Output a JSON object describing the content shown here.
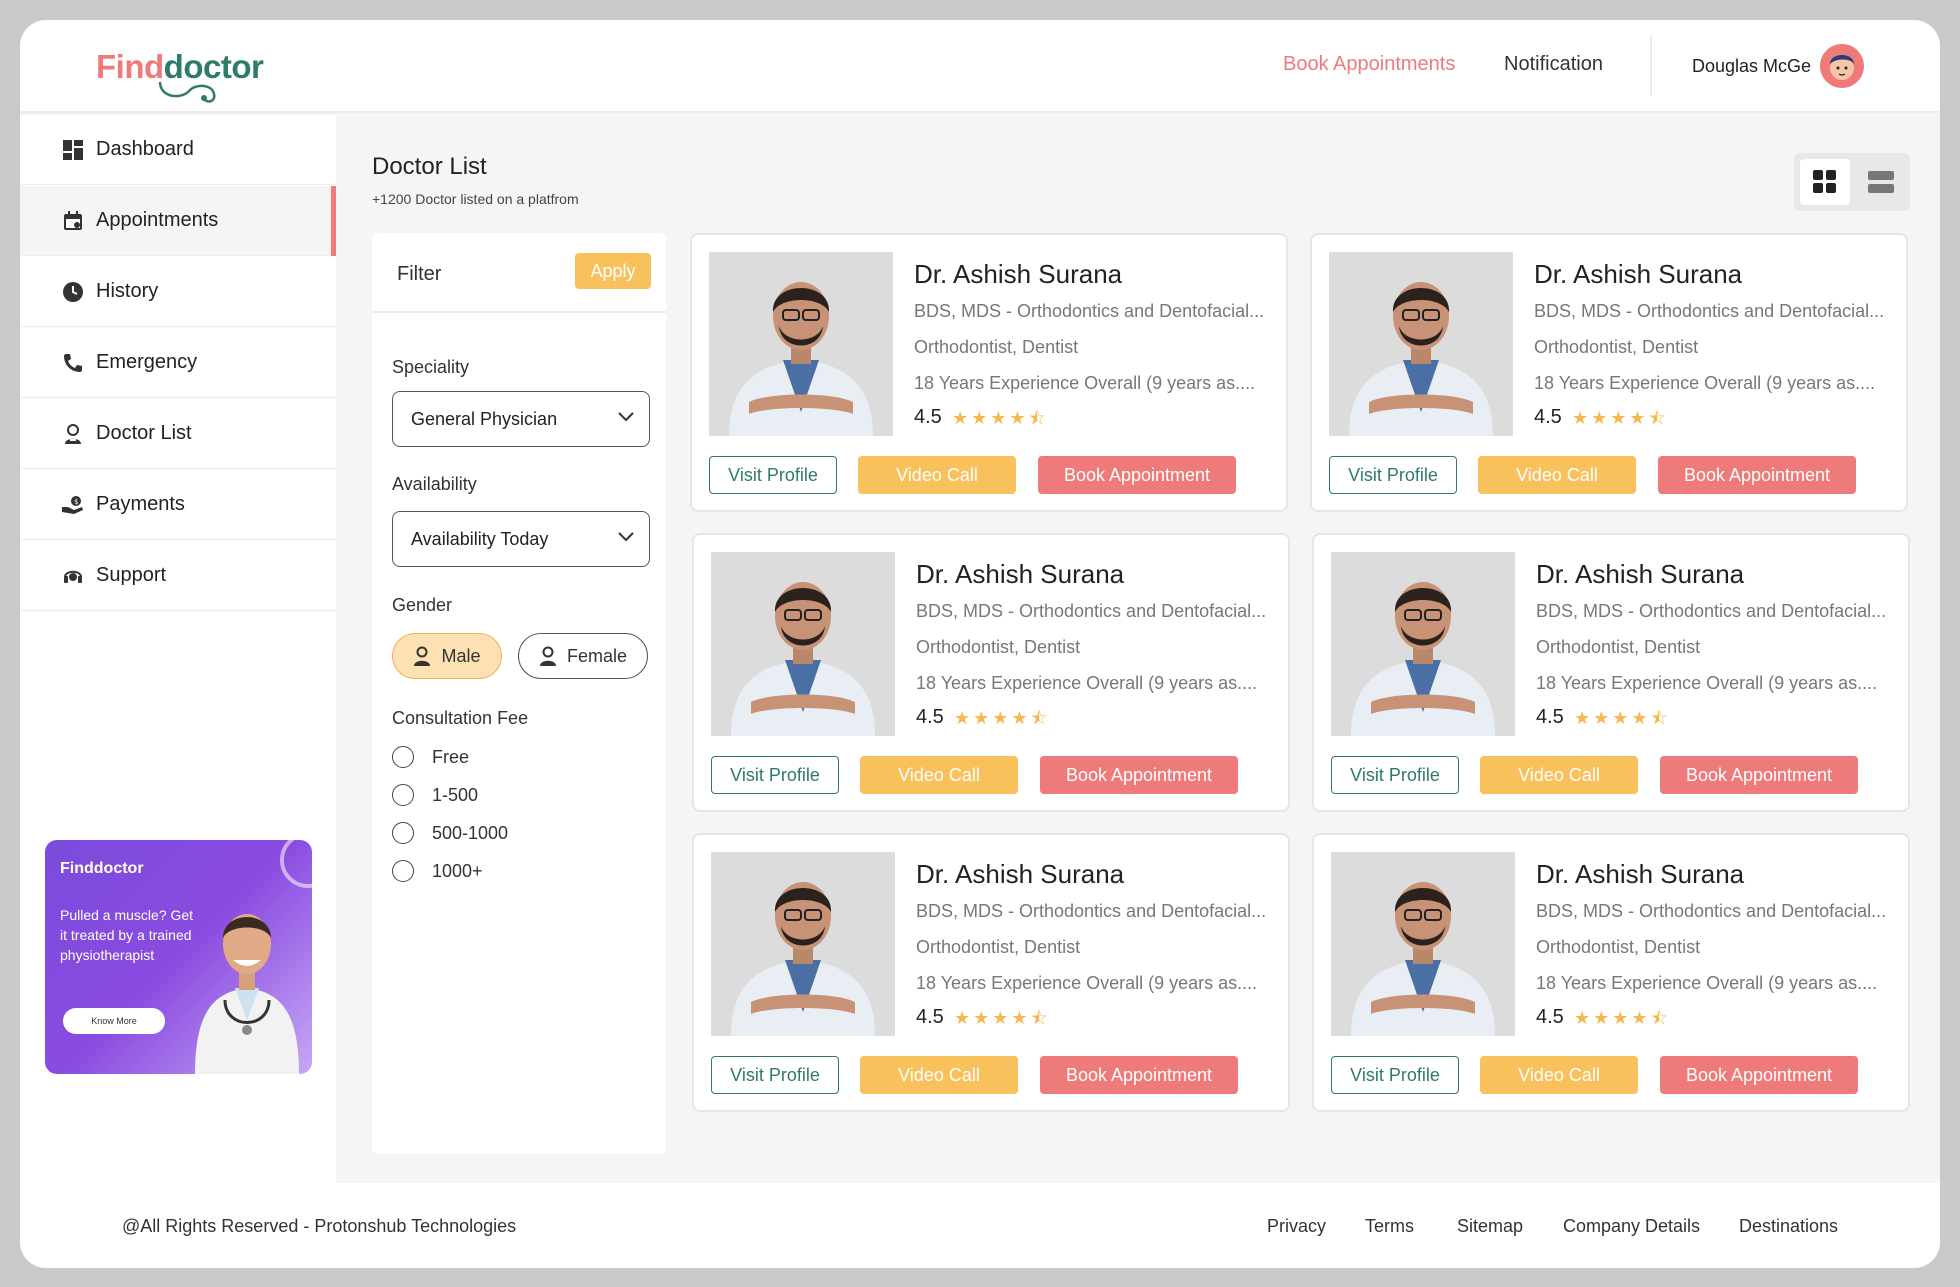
{
  "header": {
    "logo_part1": "Find",
    "logo_part2": "doctor",
    "nav_book": "Book Appointments",
    "nav_notification": "Notification",
    "user_name": "Douglas McGe"
  },
  "sidebar": {
    "items": [
      {
        "label": "Dashboard",
        "icon": "dashboard-icon"
      },
      {
        "label": "Appointments",
        "icon": "calendar-icon"
      },
      {
        "label": "History",
        "icon": "clock-icon"
      },
      {
        "label": "Emergency",
        "icon": "phone-icon"
      },
      {
        "label": "Doctor List",
        "icon": "doctor-icon"
      },
      {
        "label": "Payments",
        "icon": "payment-icon"
      },
      {
        "label": "Support",
        "icon": "headset-icon"
      }
    ],
    "active": "Appointments",
    "promo": {
      "logo": "Finddoctor",
      "text": "Pulled a muscle? Get it treated by a trained physiotherapist",
      "button": "Know More"
    }
  },
  "main": {
    "title": "Doctor List",
    "subtitle": "+1200 Doctor listed on a platfrom"
  },
  "filter": {
    "title": "Filter",
    "apply": "Apply",
    "speciality_label": "Speciality",
    "speciality_value": "General Physician",
    "availability_label": "Availability",
    "availability_value": "Availability Today",
    "gender_label": "Gender",
    "gender_male": "Male",
    "gender_female": "Female",
    "gender_selected": "Male",
    "fee_label": "Consultation Fee",
    "fee_options": [
      "Free",
      "1-500",
      "500-1000",
      "1000+"
    ]
  },
  "doctors": [
    {
      "name": "Dr. Ashish Surana",
      "qualification": "BDS, MDS - Orthodontics and Dentofacial...",
      "speciality": "Orthodontist, Dentist",
      "experience": "18 Years Experience Overall (9 years as....",
      "rating": "4.5",
      "stars": "★★★★⯪"
    },
    {
      "name": "Dr. Ashish Surana",
      "qualification": "BDS, MDS - Orthodontics and Dentofacial...",
      "speciality": "Orthodontist, Dentist",
      "experience": "18 Years Experience Overall (9 years as....",
      "rating": "4.5",
      "stars": "★★★★⯪"
    },
    {
      "name": "Dr. Ashish Surana",
      "qualification": "BDS, MDS - Orthodontics and Dentofacial...",
      "speciality": "Orthodontist, Dentist",
      "experience": "18 Years Experience Overall (9 years as....",
      "rating": "4.5",
      "stars": "★★★★⯪"
    },
    {
      "name": "Dr. Ashish Surana",
      "qualification": "BDS, MDS - Orthodontics and Dentofacial...",
      "speciality": "Orthodontist, Dentist",
      "experience": "18 Years Experience Overall (9 years as....",
      "rating": "4.5",
      "stars": "★★★★⯪"
    },
    {
      "name": "Dr. Ashish Surana",
      "qualification": "BDS, MDS - Orthodontics and Dentofacial...",
      "speciality": "Orthodontist, Dentist",
      "experience": "18 Years Experience Overall (9 years as....",
      "rating": "4.5",
      "stars": "★★★★⯪"
    },
    {
      "name": "Dr. Ashish Surana",
      "qualification": "BDS, MDS - Orthodontics and Dentofacial...",
      "speciality": "Orthodontist, Dentist",
      "experience": "18 Years Experience Overall (9 years as....",
      "rating": "4.5",
      "stars": "★★★★⯪"
    }
  ],
  "card_buttons": {
    "visit": "Visit Profile",
    "video": "Video Call",
    "book": "Book Appointment"
  },
  "footer": {
    "copyright": "@All Rights Reserved  -   Protonshub Technologies",
    "links": [
      "Privacy",
      "Terms",
      "Sitemap",
      "Company Details",
      "Destinations"
    ]
  },
  "colors": {
    "brand_pink": "#ef7a7a",
    "brand_green": "#2f7a6a",
    "accent_yellow": "#f8c15c",
    "star": "#f6b84e",
    "promo_purple": "#7a4bdc"
  }
}
